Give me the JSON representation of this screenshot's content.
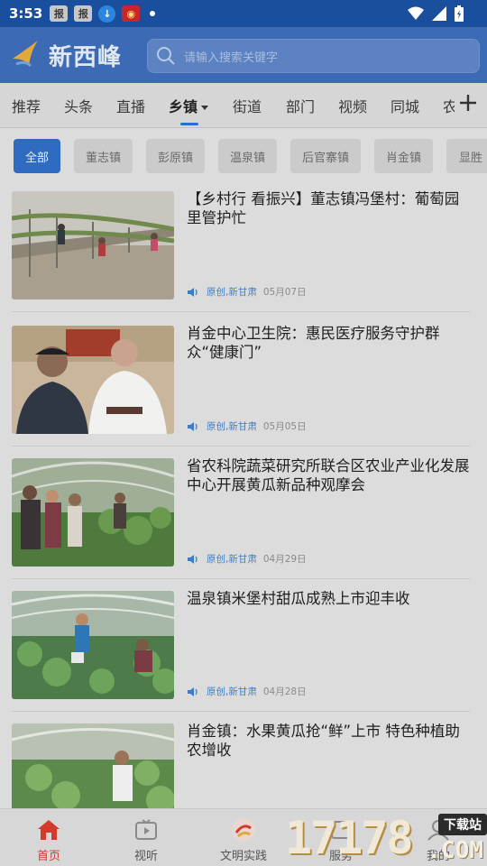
{
  "status_bar": {
    "time": "3:53",
    "icons": [
      "news-app-icon",
      "news-app-icon",
      "download-icon",
      "red-app-icon",
      "dot-icon",
      "wifi-icon",
      "signal-icon",
      "battery-icon"
    ]
  },
  "header": {
    "logo_text": "新西峰",
    "search_placeholder": "请输入搜索关键字"
  },
  "tabs": [
    {
      "label": "推荐"
    },
    {
      "label": "头条"
    },
    {
      "label": "直播"
    },
    {
      "label": "乡镇"
    },
    {
      "label": "街道"
    },
    {
      "label": "部门"
    },
    {
      "label": "视频"
    },
    {
      "label": "同城"
    },
    {
      "label": "农"
    }
  ],
  "active_tab": "乡镇",
  "chips": [
    {
      "label": "全部"
    },
    {
      "label": "董志镇"
    },
    {
      "label": "彭原镇"
    },
    {
      "label": "温泉镇"
    },
    {
      "label": "后官寨镇"
    },
    {
      "label": "肖金镇"
    },
    {
      "label": "显胜"
    }
  ],
  "articles": [
    {
      "title": "【乡村行 看振兴】董志镇冯堡村：葡萄园里管护忙",
      "source": "原创,新甘肃",
      "date": "05月07日"
    },
    {
      "title": "肖金中心卫生院：惠民医疗服务守护群众“健康门”",
      "source": "原创,新甘肃",
      "date": "05月05日"
    },
    {
      "title": "省农科院蔬菜研究所联合区农业产业化发展中心开展黄瓜新品种观摩会",
      "source": "原创,新甘肃",
      "date": "04月29日"
    },
    {
      "title": "温泉镇米堡村甜瓜成熟上市迎丰收",
      "source": "原创,新甘肃",
      "date": "04月28日"
    },
    {
      "title": "肖金镇：水果黄瓜抢“鲜”上市 特色种植助农增收",
      "source": "",
      "date": ""
    }
  ],
  "bottom_nav": [
    {
      "label": "首页"
    },
    {
      "label": "视听"
    },
    {
      "label": "文明实践"
    },
    {
      "label": "服务"
    },
    {
      "label": "我的"
    }
  ],
  "watermark": {
    "number": "17178",
    "tag": "下载站",
    "domain": ".COM"
  },
  "colors": {
    "header_bg": "#3d6ab4",
    "accent_blue": "#2f6cc1",
    "tab_underline": "#1f72d8",
    "active_nav": "#d23b2c",
    "source_blue": "#3d7dc5"
  }
}
